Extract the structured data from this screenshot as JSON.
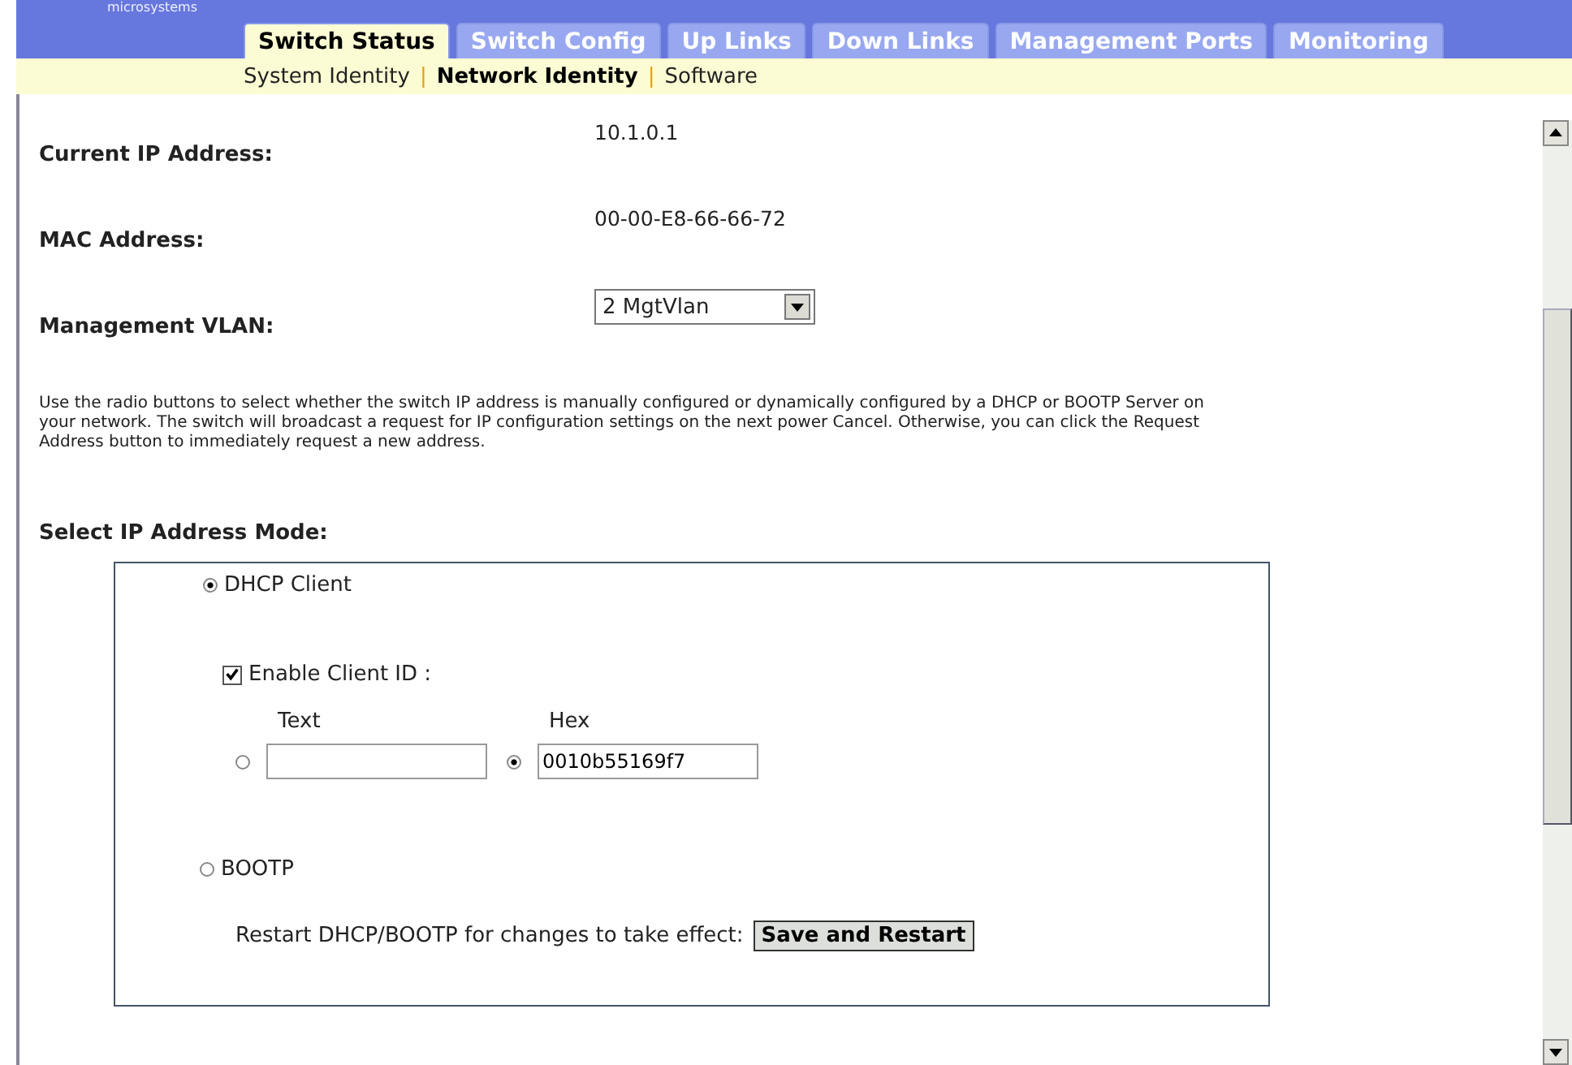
{
  "logo": {
    "text": "microsystems"
  },
  "tabs": [
    {
      "label": "Switch Status",
      "selected": true
    },
    {
      "label": "Switch Config",
      "selected": false
    },
    {
      "label": "Up Links",
      "selected": false
    },
    {
      "label": "Down Links",
      "selected": false
    },
    {
      "label": "Management Ports",
      "selected": false
    },
    {
      "label": "Monitoring",
      "selected": false
    }
  ],
  "subnav": [
    {
      "label": "System Identity",
      "selected": false
    },
    {
      "label": "Network Identity",
      "selected": true
    },
    {
      "label": "Software",
      "selected": false
    }
  ],
  "subnav_separators": [
    "|",
    "|"
  ],
  "fields": [
    {
      "label": "Current IP Address:",
      "kind": "text",
      "value": "10.1.0.1"
    },
    {
      "label": "MAC Address:",
      "kind": "text",
      "value": "00-00-E8-66-66-72"
    },
    {
      "label": "Management VLAN:",
      "kind": "select",
      "value": "2 MgtVlan"
    }
  ],
  "description": "Use the radio buttons to select whether the switch IP address is manually configured or dynamically configured by a DHCP or BOOTP Server on your network. The switch will broadcast a request for IP configuration settings on the next power Cancel. Otherwise, you can click the Request Address button to immediately request a new address.",
  "mode_heading": "Select IP Address Mode:",
  "modes": [
    {
      "label": "DHCP Client",
      "selected": true
    },
    {
      "label": "BOOTP",
      "selected": false
    }
  ],
  "client_id": {
    "label": "Enable Client ID :",
    "checked": true,
    "options": [
      {
        "label": "Text",
        "selected": false
      },
      {
        "label": "Hex",
        "value": "0010b55169f7",
        "selected": true
      }
    ]
  },
  "restart": {
    "text": "Restart DHCP/BOOTP for changes to take effect:",
    "button": "Save and Restart"
  }
}
